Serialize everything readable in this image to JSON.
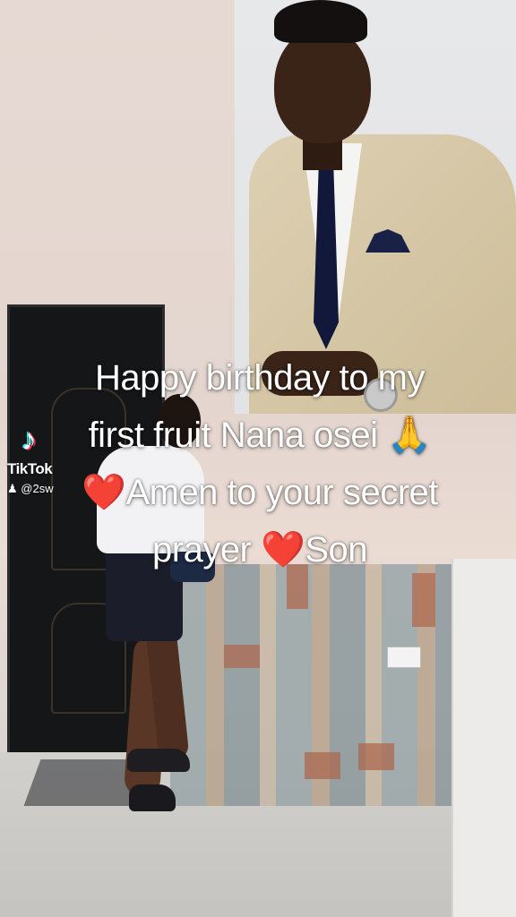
{
  "watermark": {
    "logo_icon": "tiktok-note-icon",
    "logo_glyph": "♪",
    "brand": "TikTok",
    "username": "@2sw"
  },
  "caption": {
    "line1": "Happy birthday to my",
    "line2": "first fruit Nana osei 🙏",
    "line3_heart": "❤️",
    "line3_text": "Amen to your secret",
    "line4_text_a": "prayer ",
    "line4_heart": "❤️",
    "line4_text_b": "Son"
  },
  "colors": {
    "caption_text": "#ffffff",
    "heart": "#ea1d2c"
  }
}
